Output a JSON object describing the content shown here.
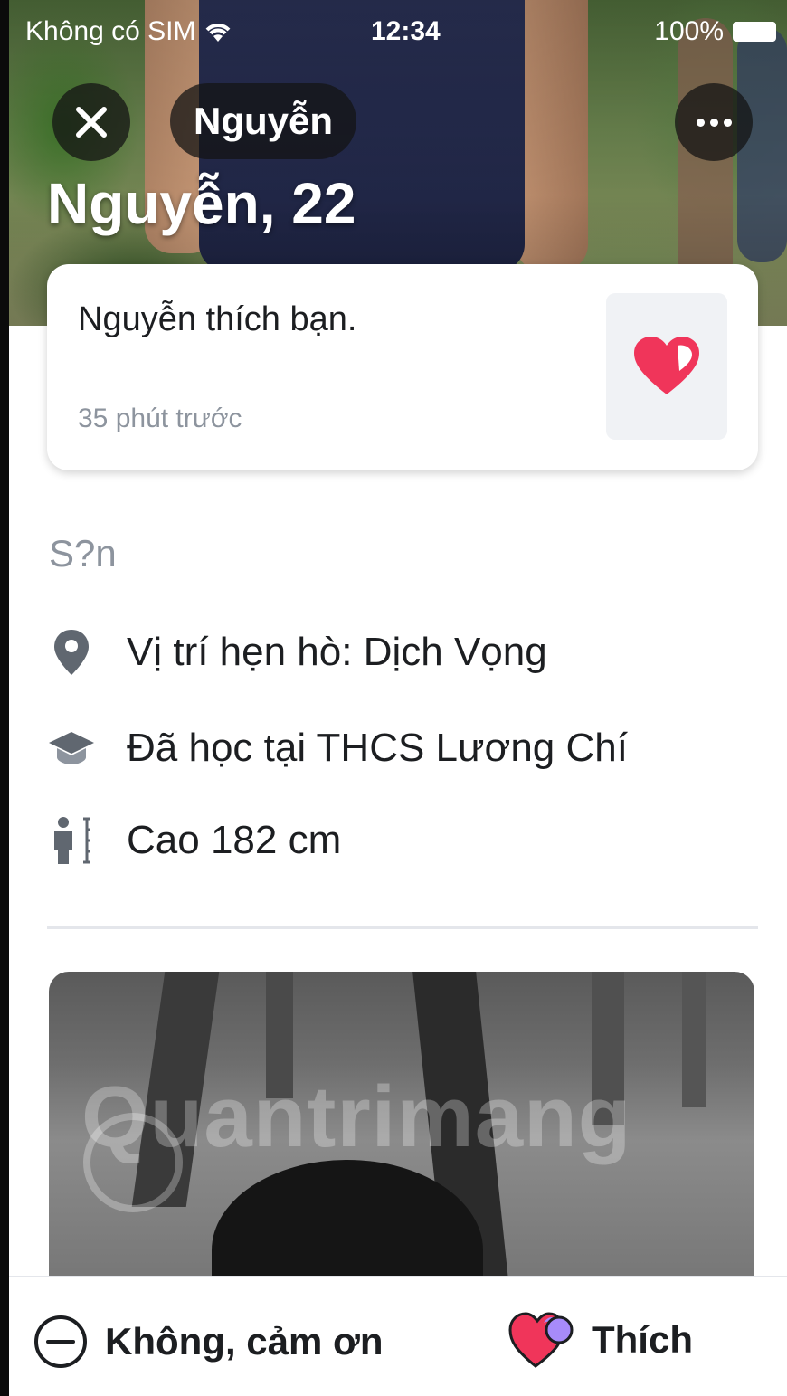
{
  "status_bar": {
    "carrier": "Không có SIM",
    "time": "12:34",
    "battery": "100%"
  },
  "header": {
    "name_pill": "Nguyễn",
    "headline": "Nguyễn, 22"
  },
  "like_card": {
    "message": "Nguyễn thích bạn.",
    "time_ago": "35 phút trước"
  },
  "profile": {
    "section_title": "S?n",
    "info": [
      {
        "icon": "location-pin-icon",
        "text": "Vị trí hẹn hò: Dịch Vọng"
      },
      {
        "icon": "graduation-cap-icon",
        "text": "Đã học tại THCS Lương Chí"
      },
      {
        "icon": "height-icon",
        "text": "Cao 182 cm"
      }
    ]
  },
  "photo": {
    "watermark": "Quantrimang"
  },
  "actions": {
    "decline_label": "Không, cảm ơn",
    "like_label": "Thích"
  },
  "colors": {
    "heart_red": "#f0355a",
    "heart_purple": "#a78bfa",
    "muted_text": "#8d949e"
  }
}
